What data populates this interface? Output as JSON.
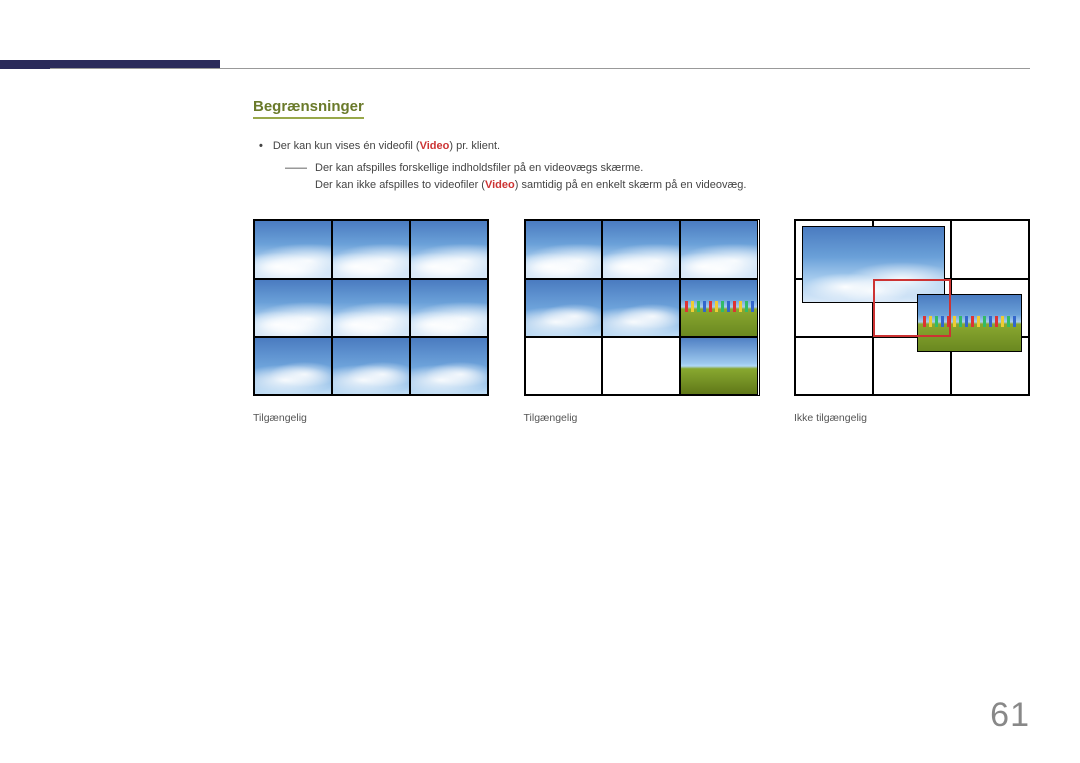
{
  "section_title": "Begrænsninger",
  "bullet": {
    "pre": "Der kan kun vises én videofil (",
    "video": "Video",
    "post": ") pr. klient."
  },
  "sub": {
    "line1": "Der kan afspilles forskellige indholdsfiler på en videovægs skærme.",
    "line2_pre": "Der kan ikke afspilles to videofiler (",
    "line2_video": "Video",
    "line2_post": ") samtidig på en enkelt skærm på en videovæg."
  },
  "captions": {
    "c1": "Tilgængelig",
    "c2": "Tilgængelig",
    "c3": "Ikke tilgængelig"
  },
  "page_number": "61"
}
